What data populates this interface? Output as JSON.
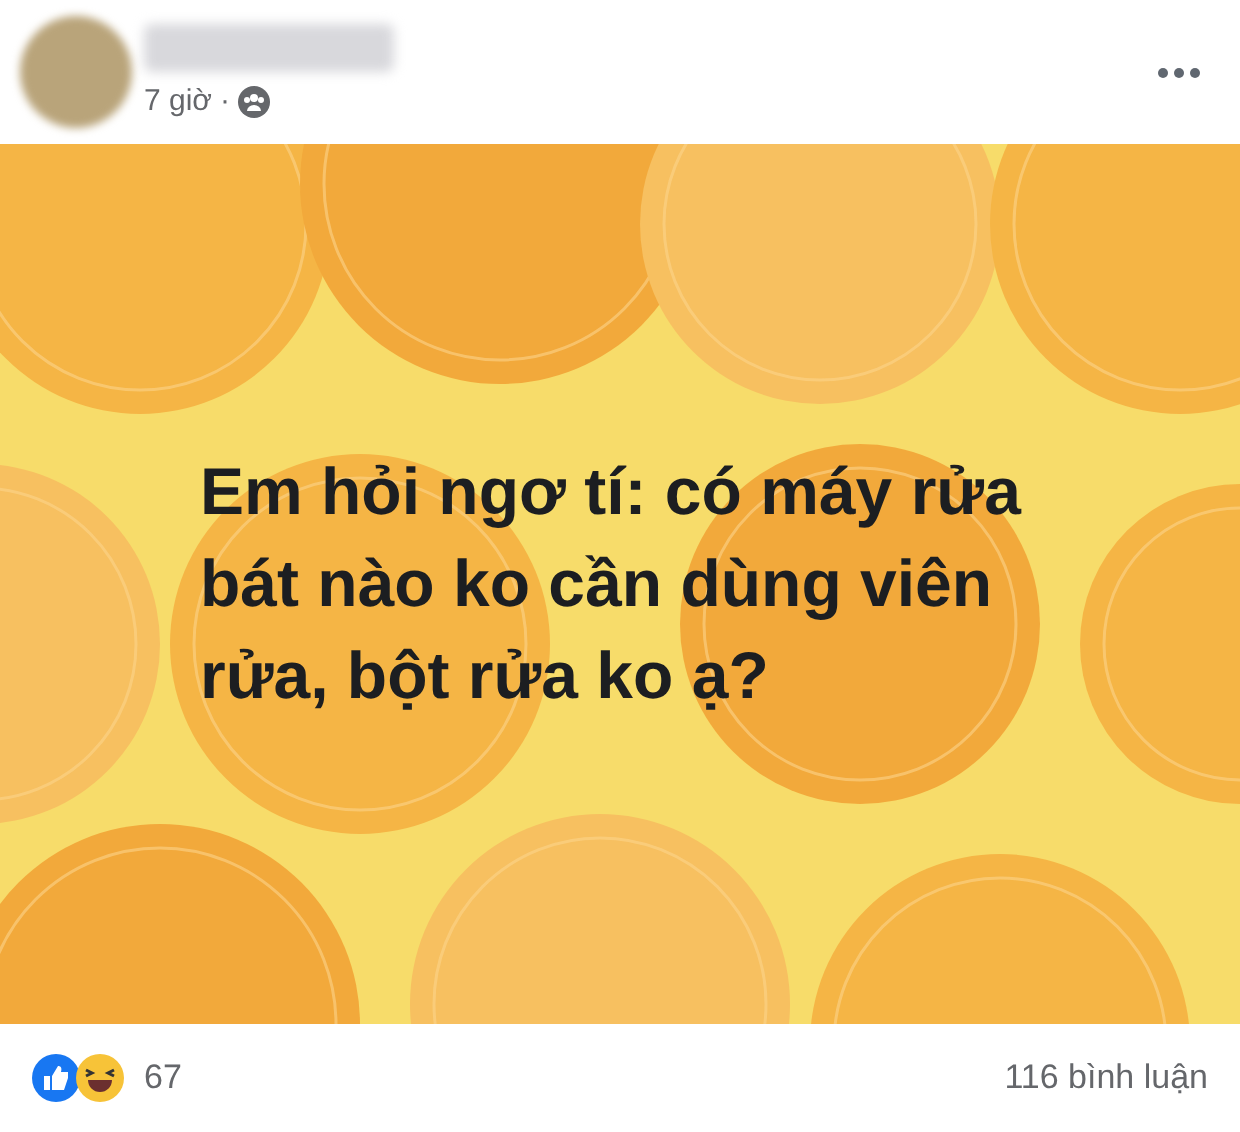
{
  "post": {
    "time": "7 giờ",
    "separator": "·"
  },
  "card": {
    "text": "Em hỏi ngơ tí: có máy rửa bát nào ko cần dùng viên rửa, bột rửa ko ạ?"
  },
  "footer": {
    "reaction_count": "67",
    "comments": "116 bình luận"
  }
}
